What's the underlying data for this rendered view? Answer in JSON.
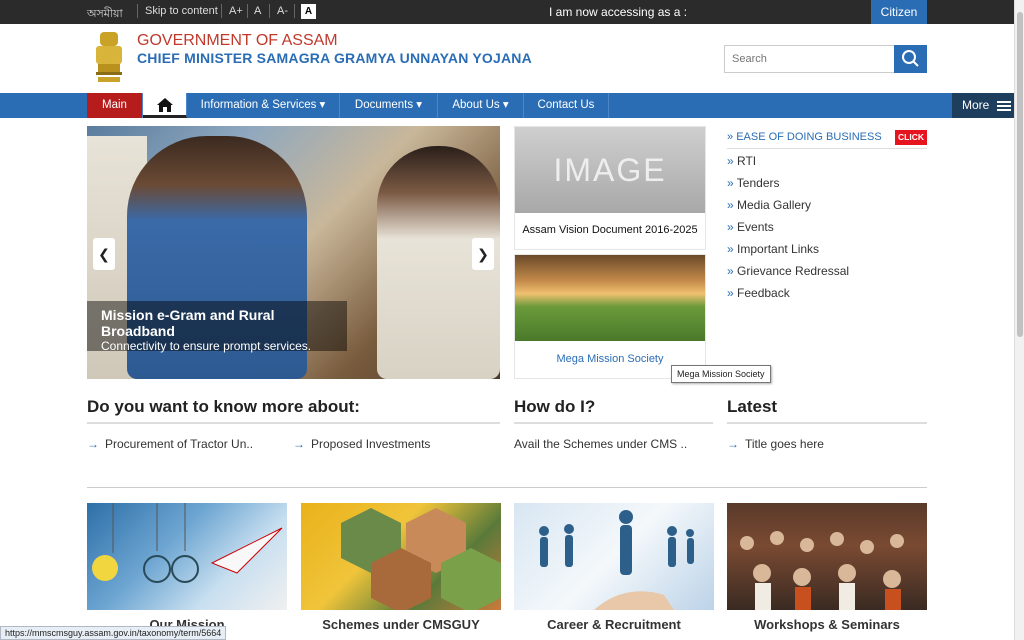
{
  "topbar": {
    "lang": "অসমীয়া",
    "skip": "Skip to content",
    "font_plus": "A+",
    "font_normal": "A",
    "font_minus": "A-",
    "contrast": "A",
    "accessing": "I am now accessing as a :",
    "citizen": "Citizen"
  },
  "header": {
    "gov": "GOVERNMENT OF ASSAM",
    "scheme": "CHIEF MINISTER SAMAGRA GRAMYA UNNAYAN YOJANA",
    "search_placeholder": "Search"
  },
  "nav": {
    "main": "Main",
    "items": [
      "Information & Services ▾",
      "Documents ▾",
      "About Us ▾",
      "Contact Us"
    ],
    "more": "More"
  },
  "slider": {
    "title": "Mission e-Gram and Rural Broadband",
    "subtitle": "Connectivity to ensure prompt services."
  },
  "cards": {
    "c1_img": "IMAGE",
    "c1_label": "Assam Vision Document 2016-2025",
    "c2_label": "Mega Mission Society",
    "tooltip": "Mega Mission Society"
  },
  "right_links": {
    "ease": "EASE OF DOING BUSINESS",
    "click": "CLICK",
    "items": [
      "RTI",
      "Tenders",
      "Media Gallery",
      "Events",
      "Important Links",
      "Grievance Redressal",
      "Feedback"
    ]
  },
  "sections": {
    "know": "Do you want to know more about:",
    "know_items": [
      "Procurement of Tractor Un..",
      "Proposed Investments"
    ],
    "howdo": "How do I?",
    "howdo_item": "Avail the Schemes under CMS ..",
    "latest": "Latest",
    "latest_item": "Title goes here"
  },
  "tiles": [
    "Our Mission",
    "Schemes under CMSGUY",
    "Career & Recruitment",
    "Workshops & Seminars"
  ],
  "status_url": "https://mmscmsguy.assam.gov.in/taxonomy/term/5664"
}
